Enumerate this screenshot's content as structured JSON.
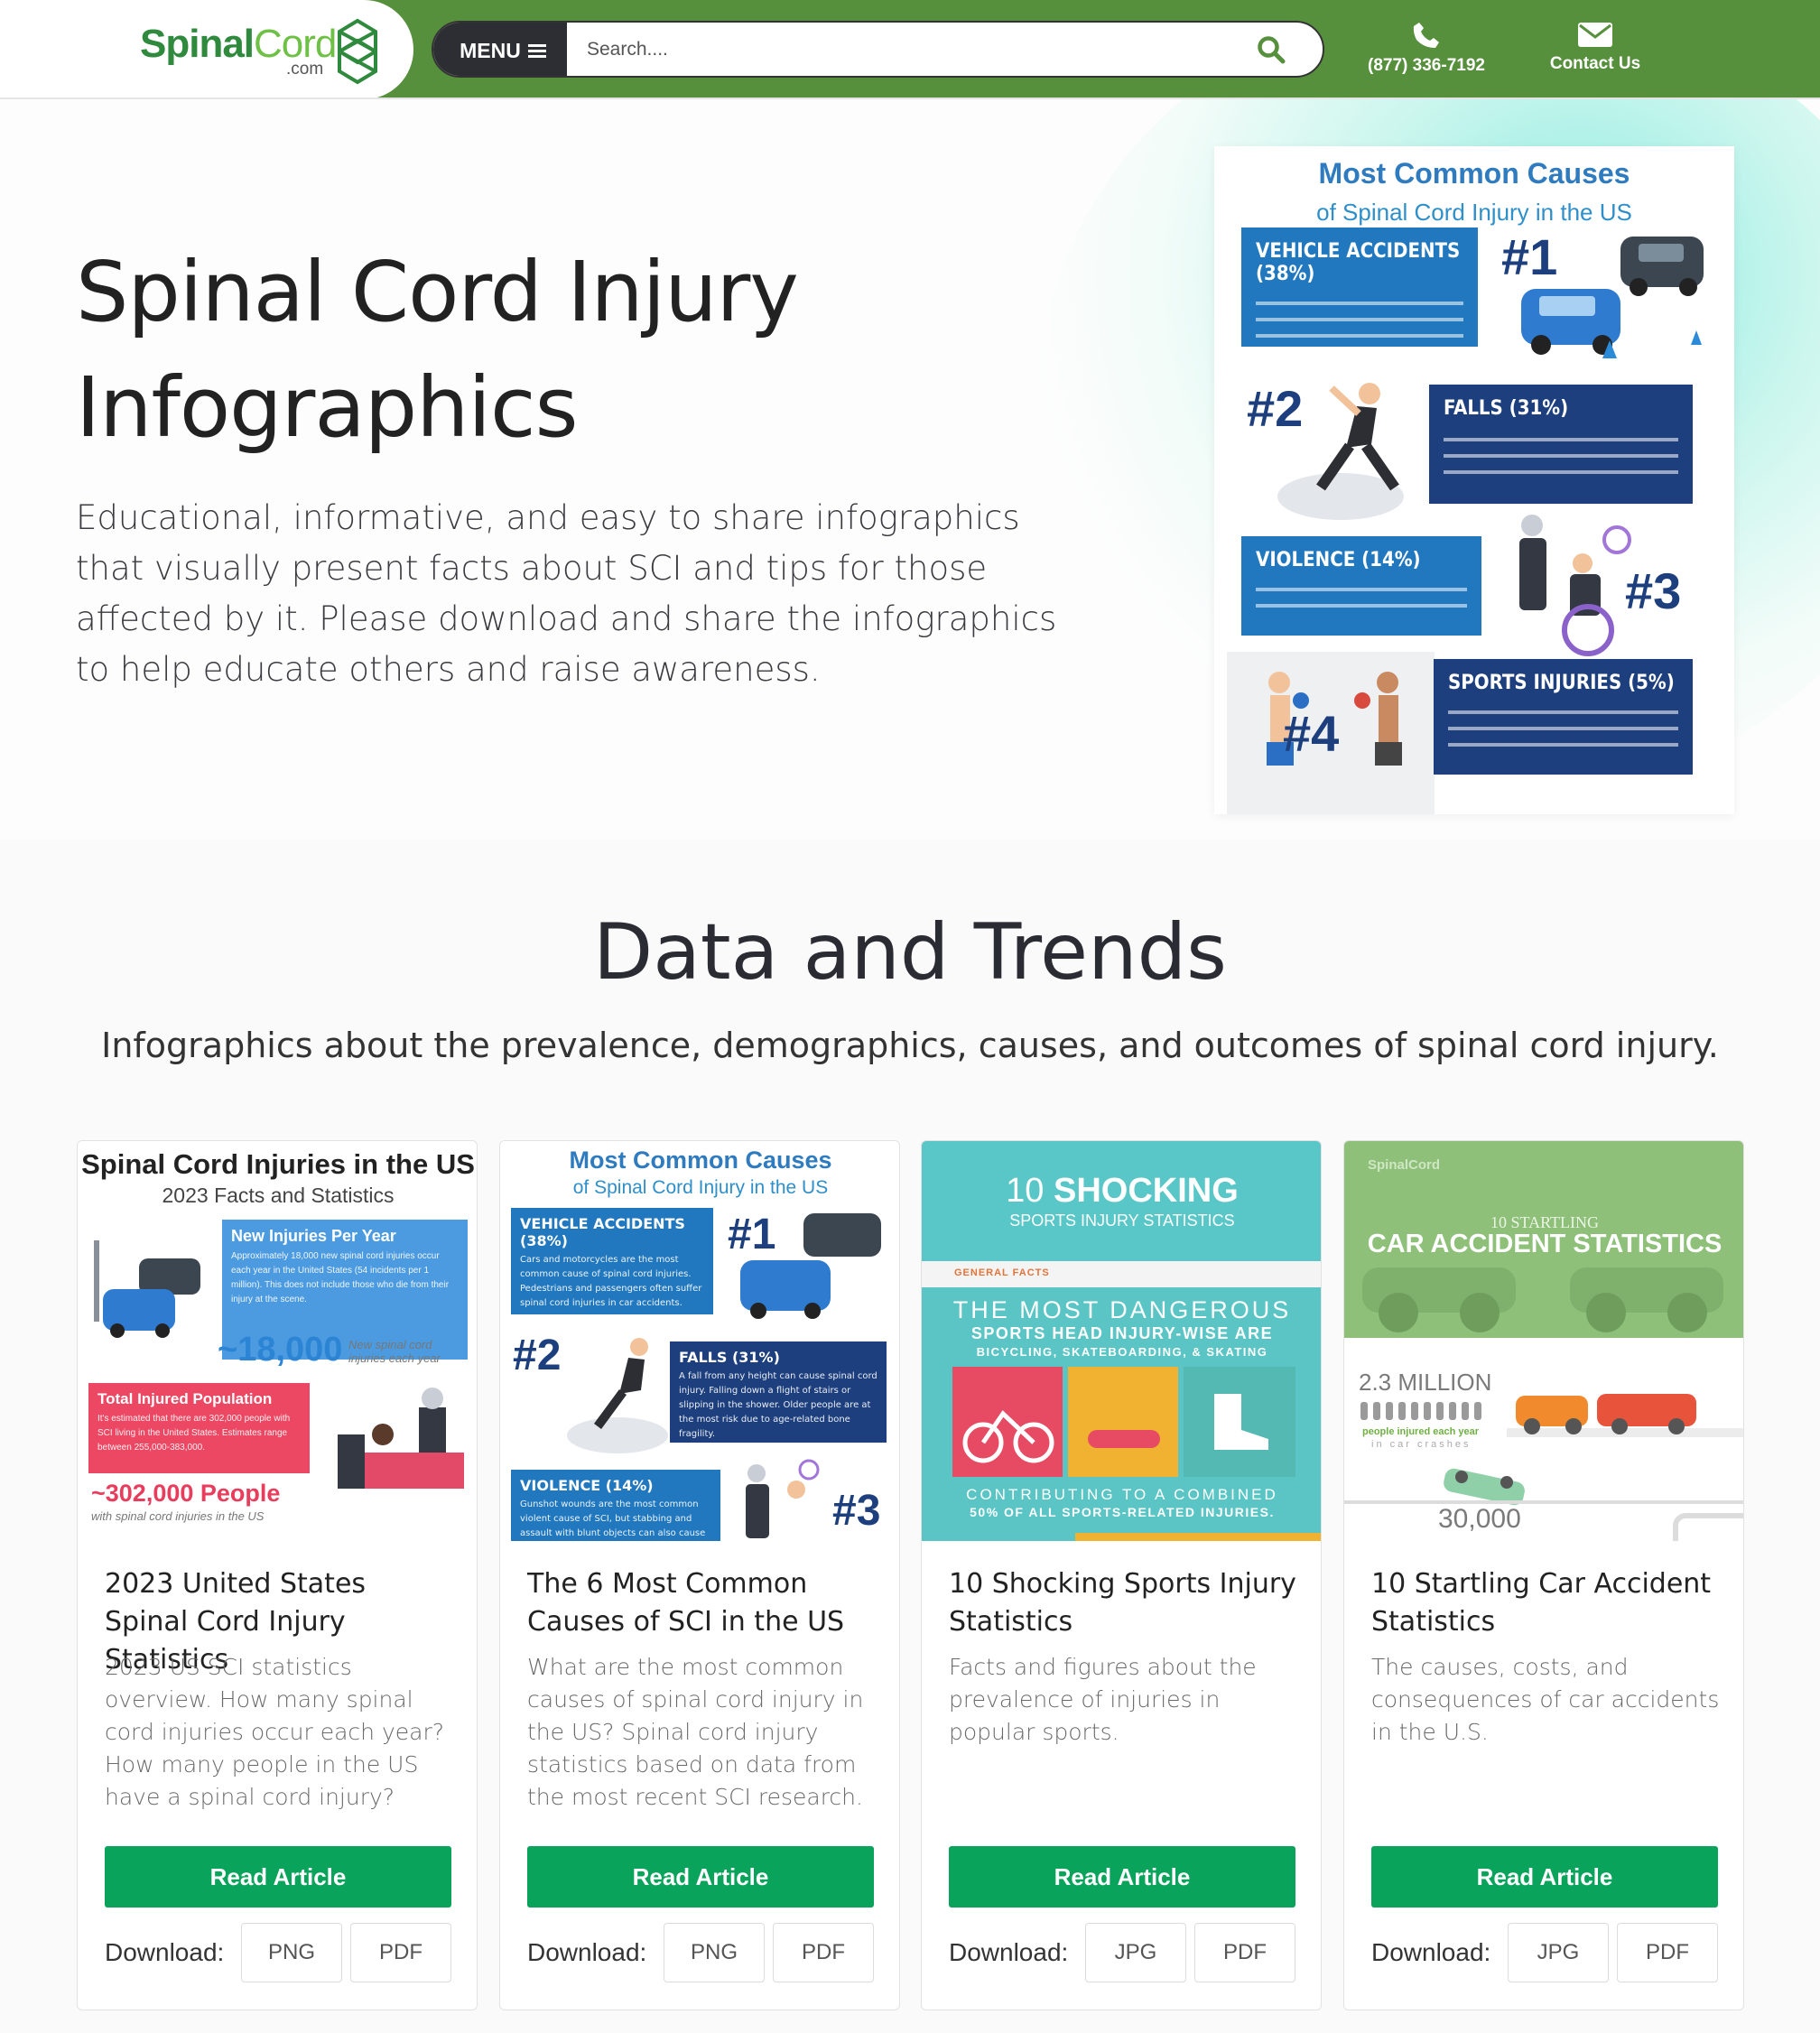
{
  "header": {
    "logo_spinal": "Spinal",
    "logo_cord": "Cord",
    "logo_com": ".com",
    "menu_label": "MENU",
    "search_placeholder": "Search....",
    "phone": "(877) 336-7192",
    "contact": "Contact Us",
    "brand_green": "#57903c"
  },
  "hero": {
    "title_line1": "Spinal Cord Injury",
    "title_line2": "Infographics",
    "description": "Educational, informative, and easy to share infographics that visually present facts about SCI and tips for those affected by it. Please download and share the infographics to help educate others and raise awareness.",
    "infographic": {
      "title": "Most Common Causes",
      "subtitle": "of Spinal Cord Injury in the US",
      "items": [
        {
          "label": "VEHICLE ACCIDENTS (38%)",
          "rank": "#1"
        },
        {
          "label": "FALLS (31%)",
          "rank": "#2"
        },
        {
          "label": "VIOLENCE (14%)",
          "rank": "#3"
        },
        {
          "label": "SPORTS INJURIES (5%)",
          "rank": "#4"
        }
      ]
    }
  },
  "section": {
    "title": "Data and Trends",
    "subtitle": "Infographics about the prevalence, demographics, causes, and outcomes of spinal cord injury."
  },
  "cards": [
    {
      "title": "2023 United States Spinal Cord Injury Statistics",
      "description": "2023 US SCI statistics overview. How many spinal cord injuries occur each year? How many people in the US have a spinal cord injury?",
      "button": "Read Article",
      "download_label": "Download:",
      "formats": [
        "PNG",
        "PDF"
      ],
      "thumb": {
        "title": "Spinal Cord Injuries in the US",
        "subtitle": "2023 Facts and Statistics",
        "box1_title": "New Injuries Per Year",
        "box1_text": "Approximately 18,000 new spinal cord injuries occur each year in the United States (54 incidents per 1 million). This does not include those who die from their injury at the scene.",
        "num1": "~18,000",
        "num1_caption": "New spinal cord injuries each year",
        "box2_title": "Total Injured Population",
        "box2_text": "It's estimated that there are 302,000 people with SCI living in the United States. Estimates range between 255,000-383,000.",
        "num2": "~302,000 People",
        "num2_caption": "with spinal cord injuries in the US"
      }
    },
    {
      "title": "The 6 Most Common Causes of SCI in the US",
      "description": "What are the most common causes of spinal cord injury in the US? Spinal cord injury statistics based on data from the most recent SCI research.",
      "button": "Read Article",
      "download_label": "Download:",
      "formats": [
        "PNG",
        "PDF"
      ],
      "thumb": {
        "title": "Most Common Causes",
        "subtitle": "of Spinal Cord Injury in the US",
        "b1": "VEHICLE ACCIDENTS (38%)",
        "b1_text": "Cars and motorcycles are the most common cause of spinal cord injuries. Pedestrians and passengers often suffer spinal cord injuries in car accidents.",
        "b2": "FALLS (31%)",
        "b2_text": "A fall from any height can cause spinal cord injury. Falling down a flight of stairs or slipping in the shower. Older people are at the most risk due to age-related bone fragility.",
        "b3": "VIOLENCE (14%)",
        "b3_text": "Gunshot wounds are the most common violent cause of SCI, but stabbing and assault with blunt objects can also cause SCI.",
        "r1": "#1",
        "r2": "#2",
        "r3": "#3"
      }
    },
    {
      "title": "10 Shocking Sports Injury Statistics",
      "description": "Facts and figures about the prevalence of injuries in popular sports.",
      "button": "Read Article",
      "download_label": "Download:",
      "formats": [
        "JPG",
        "PDF"
      ],
      "thumb": {
        "title_num": "10",
        "title_word": "SHOCKING",
        "subtitle": "SPORTS INJURY STATISTICS",
        "tag": "GENERAL FACTS",
        "line1": "THE MOST DANGEROUS",
        "line2": "SPORTS HEAD INJURY-WISE ARE",
        "line3": "BICYCLING, SKATEBOARDING, & SKATING",
        "foot1": "CONTRIBUTING TO A COMBINED",
        "foot2": "50% OF ALL SPORTS-RELATED INJURIES."
      }
    },
    {
      "title": "10 Startling Car Accident Statistics",
      "description": "The causes, costs, and consequences of car accidents in the U.S.",
      "button": "Read Article",
      "download_label": "Download:",
      "formats": [
        "JPG",
        "PDF"
      ],
      "thumb": {
        "brand": "SpinalCord",
        "kicker": "10 STARTLING",
        "title": "CAR ACCIDENT STATISTICS",
        "stat1": "2.3 MILLION",
        "stat1_caption": "people injured each year",
        "stat1_caption2": "in car crashes",
        "stat2": "30,000"
      }
    }
  ]
}
